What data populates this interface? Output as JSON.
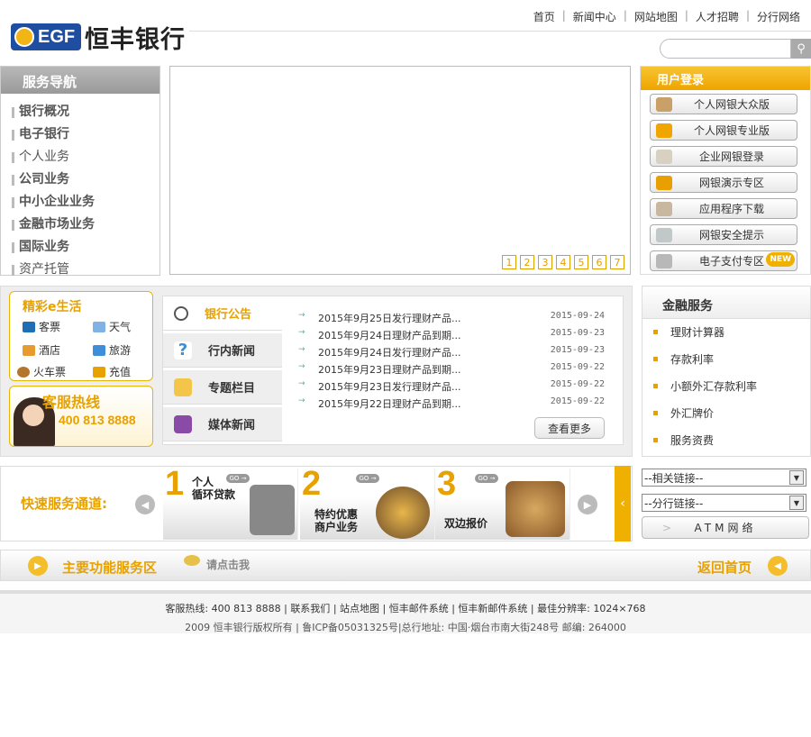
{
  "brand": {
    "logo_text": "EGF",
    "name_cn": "恒丰银行",
    "accent": "#e7a100",
    "blue": "#1f4ea0"
  },
  "topnav": [
    "首页",
    "新闻中心",
    "网站地图",
    "人才招聘",
    "分行网络"
  ],
  "search": {
    "placeholder": "",
    "icon": "search-icon"
  },
  "nav": {
    "title": "服务导航",
    "items": [
      "银行概况",
      "电子银行",
      "个人业务",
      "公司业务",
      "中小企业业务",
      "金融市场业务",
      "国际业务",
      "资产托管"
    ]
  },
  "banner": {
    "pages": [
      "1",
      "2",
      "3",
      "4",
      "5",
      "6",
      "7"
    ]
  },
  "login": {
    "title": "用户登录",
    "buttons": [
      "个人网银大众版",
      "个人网银专业版",
      "企业网银登录",
      "网银演示专区",
      "应用程序下载",
      "网银安全提示",
      "电子支付专区"
    ],
    "new_badge": "NEW"
  },
  "elife": {
    "title": "精彩e生活",
    "items": [
      "客票",
      "天气",
      "酒店",
      "旅游",
      "火车票",
      "充值"
    ]
  },
  "hotline": {
    "title": "客服热线",
    "number": "400 813 8888"
  },
  "news": {
    "tabs": [
      "银行公告",
      "行内新闻",
      "专题栏目",
      "媒体新闻"
    ],
    "items": [
      {
        "title": "2015年9月25日发行理财产品...",
        "date": "2015-09-24"
      },
      {
        "title": "2015年9月24日理财产品到期...",
        "date": "2015-09-23"
      },
      {
        "title": "2015年9月24日发行理财产品...",
        "date": "2015-09-23"
      },
      {
        "title": "2015年9月23日理财产品到期...",
        "date": "2015-09-22"
      },
      {
        "title": "2015年9月23日发行理财产品...",
        "date": "2015-09-22"
      },
      {
        "title": "2015年9月22日理财产品到期...",
        "date": "2015-09-22"
      }
    ],
    "more": "查看更多"
  },
  "finance": {
    "title": "金融服务",
    "items": [
      "理财计算器",
      "存款利率",
      "小额外汇存款利率",
      "外汇牌价",
      "服务资费"
    ]
  },
  "quick": {
    "label": "快速服务通道:",
    "cards": [
      {
        "num": "1",
        "text1": "个人",
        "text2": "循环贷款"
      },
      {
        "num": "2",
        "text1": "特约优惠",
        "text2": "商户业务"
      },
      {
        "num": "3",
        "text1": "",
        "text2": "双边报价"
      }
    ],
    "go": "GO →"
  },
  "links": {
    "related": "--相关链接--",
    "branch": "--分行链接--",
    "atm": "ATM网络"
  },
  "mainbar": {
    "title": "主要功能服务区",
    "hint": "请点击我",
    "back": "返回首页"
  },
  "footer": {
    "line1": [
      "客服热线: 400 813 8888",
      "联系我们",
      "站点地图",
      "恒丰邮件系统",
      "恒丰新邮件系统",
      "最佳分辨率: 1024×768"
    ],
    "line2": "2009 恒丰银行版权所有 | 鲁ICP备05031325号|总行地址: 中国·烟台市南大街248号 邮编: 264000"
  }
}
